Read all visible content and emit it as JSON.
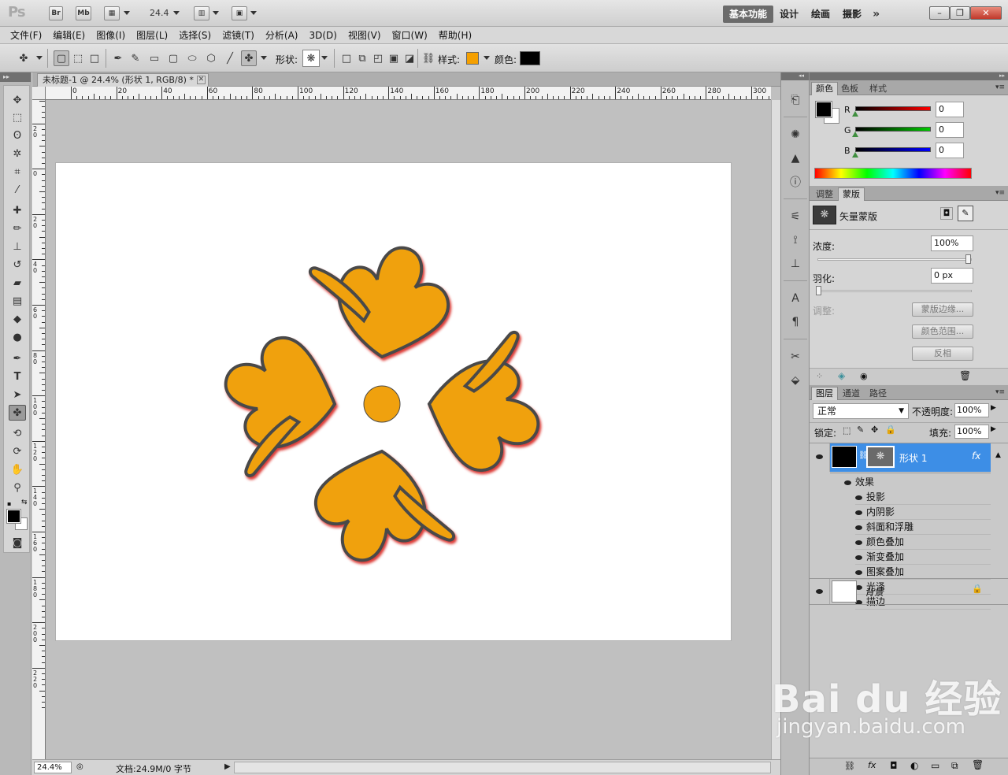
{
  "app": {
    "logo": "Ps",
    "bridge_label": "Br",
    "minibridge_label": "Mb",
    "zoom_value": "24.4",
    "workspaces": [
      "基本功能",
      "设计",
      "绘画",
      "摄影"
    ],
    "workspace_more": "»"
  },
  "menubar": [
    "文件(F)",
    "编辑(E)",
    "图像(I)",
    "图层(L)",
    "选择(S)",
    "滤镜(T)",
    "分析(A)",
    "3D(D)",
    "视图(V)",
    "窗口(W)",
    "帮助(H)"
  ],
  "options": {
    "shape_label": "形状:",
    "style_label": "样式:",
    "color_label": "颜色:",
    "style_color": "#f5a000",
    "fill_color": "#000000"
  },
  "document": {
    "tab_title": "未标题-1 @ 24.4% (形状 1, RGB/8) *",
    "ruler_h_labels": [
      "0",
      "20",
      "40",
      "60",
      "80",
      "100",
      "120",
      "140",
      "160",
      "180",
      "200",
      "220",
      "240",
      "260",
      "280",
      "300"
    ],
    "ruler_v_labels": [
      "40",
      "20",
      "0",
      "20",
      "40",
      "60",
      "80",
      "100",
      "120",
      "140",
      "160",
      "180",
      "200",
      "220"
    ],
    "status_zoom": "24.4%",
    "status_doc": "文档:24.9M/0 字节"
  },
  "artwork": {
    "fill": "#f0a10e",
    "outline": "#4a4a4a",
    "edge": "#d8241a"
  },
  "color_panel": {
    "tabs": [
      "颜色",
      "色板",
      "样式"
    ],
    "r_label": "R",
    "g_label": "G",
    "b_label": "B",
    "r": "0",
    "g": "0",
    "b": "0"
  },
  "mask_panel": {
    "tabs": [
      "调整",
      "蒙版"
    ],
    "title": "矢量蒙版",
    "density_label": "浓度:",
    "density_value": "100%",
    "feather_label": "羽化:",
    "feather_value": "0 px",
    "refine_label": "调整:",
    "btn_mask_edge": "蒙版边缘...",
    "btn_color_range": "颜色范围...",
    "btn_invert": "反相"
  },
  "layers_panel": {
    "tabs": [
      "图层",
      "通道",
      "路径"
    ],
    "blend_mode": "正常",
    "opacity_label": "不透明度:",
    "opacity_value": "100%",
    "lock_label": "锁定:",
    "fill_label": "填充:",
    "fill_value": "100%",
    "layer_shape": "形状 1",
    "effects_label": "效果",
    "effects": [
      "投影",
      "内阴影",
      "斜面和浮雕",
      "颜色叠加",
      "渐变叠加",
      "图案叠加",
      "光泽",
      "描边"
    ],
    "layer_background": "背景",
    "fx_label": "fx"
  },
  "watermark": {
    "brand": "Bai du 经验",
    "url": "jingyan.baidu.com"
  }
}
